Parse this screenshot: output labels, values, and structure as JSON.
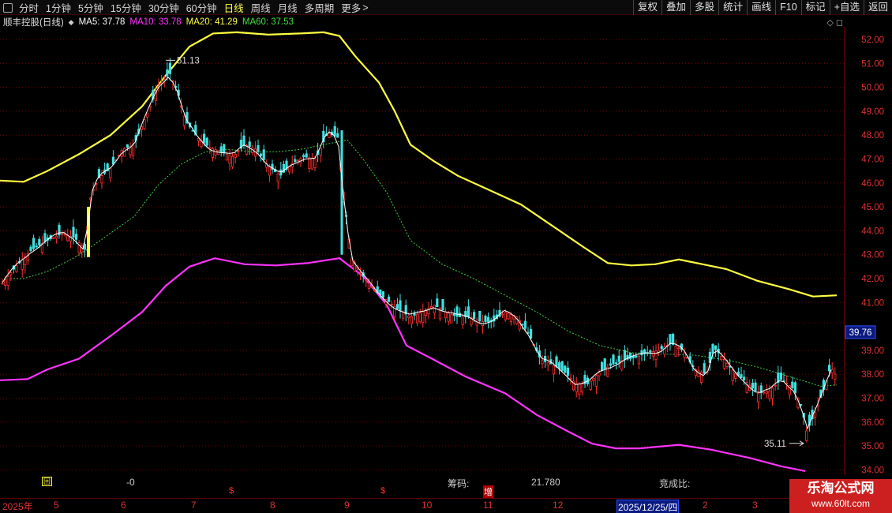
{
  "toolbar": {
    "pin_icon": "pin-icon",
    "periods": [
      {
        "label": "分时",
        "active": false
      },
      {
        "label": "1分钟",
        "active": false
      },
      {
        "label": "5分钟",
        "active": false
      },
      {
        "label": "15分钟",
        "active": false
      },
      {
        "label": "30分钟",
        "active": false
      },
      {
        "label": "60分钟",
        "active": false
      },
      {
        "label": "日线",
        "active": true
      },
      {
        "label": "周线",
        "active": false
      },
      {
        "label": "月线",
        "active": false
      },
      {
        "label": "多周期",
        "active": false
      },
      {
        "label": "更多",
        "active": false
      }
    ],
    "more_chevron": ">",
    "actions": [
      "复权",
      "叠加",
      "多股",
      "统计",
      "画线",
      "F10",
      "标记",
      "+自选",
      "返回"
    ]
  },
  "legend": {
    "title": "顺丰控股(日线)",
    "indicator": "◆",
    "ma5": "MA5: 37.78",
    "ma10": "MA10: 33.78",
    "ma20": "MA20: 41.29",
    "ma60": "MA60: 37.53",
    "colors": {
      "ma5": "#ffffff",
      "ma10": "#ff33ff",
      "ma20": "#ffff40",
      "ma60": "#40e040"
    }
  },
  "tools_mini": "◇ ◻",
  "chart_data": {
    "type": "candlestick",
    "price_ticks": [
      "52.00",
      "51.00",
      "50.00",
      "49.00",
      "48.00",
      "47.00",
      "46.00",
      "45.00",
      "44.00",
      "43.00",
      "42.00",
      "41.00",
      "39.00",
      "38.00",
      "37.00",
      "36.00",
      "35.00",
      "34.00"
    ],
    "current_price": "39.76",
    "annotations": {
      "high": "51.13",
      "low": "35.11"
    },
    "ylim": [
      34,
      52.3
    ],
    "colors": {
      "up": "#ff3030",
      "down": "#40e0e0",
      "upper_band": "#ffff40",
      "lower_band": "#ff33ff",
      "mid_line": "#40d040",
      "ma5": "#ffffff"
    }
  },
  "bottom_info": {
    "value": "-0",
    "chips_label": "筹码:",
    "chips_value": "21.780",
    "bid_label": "竞成比:",
    "badge": "增",
    "marker_1": "$",
    "marker_2": "$",
    "square_icon": "回"
  },
  "date_axis": {
    "labels": [
      "2025年",
      "5",
      "6",
      "7",
      "8",
      "9",
      "10",
      "11",
      "12",
      "2025/12/25/四",
      "2",
      "3"
    ]
  },
  "watermark": {
    "line1": "乐淘公式网",
    "line2": "www.60lt.com"
  }
}
